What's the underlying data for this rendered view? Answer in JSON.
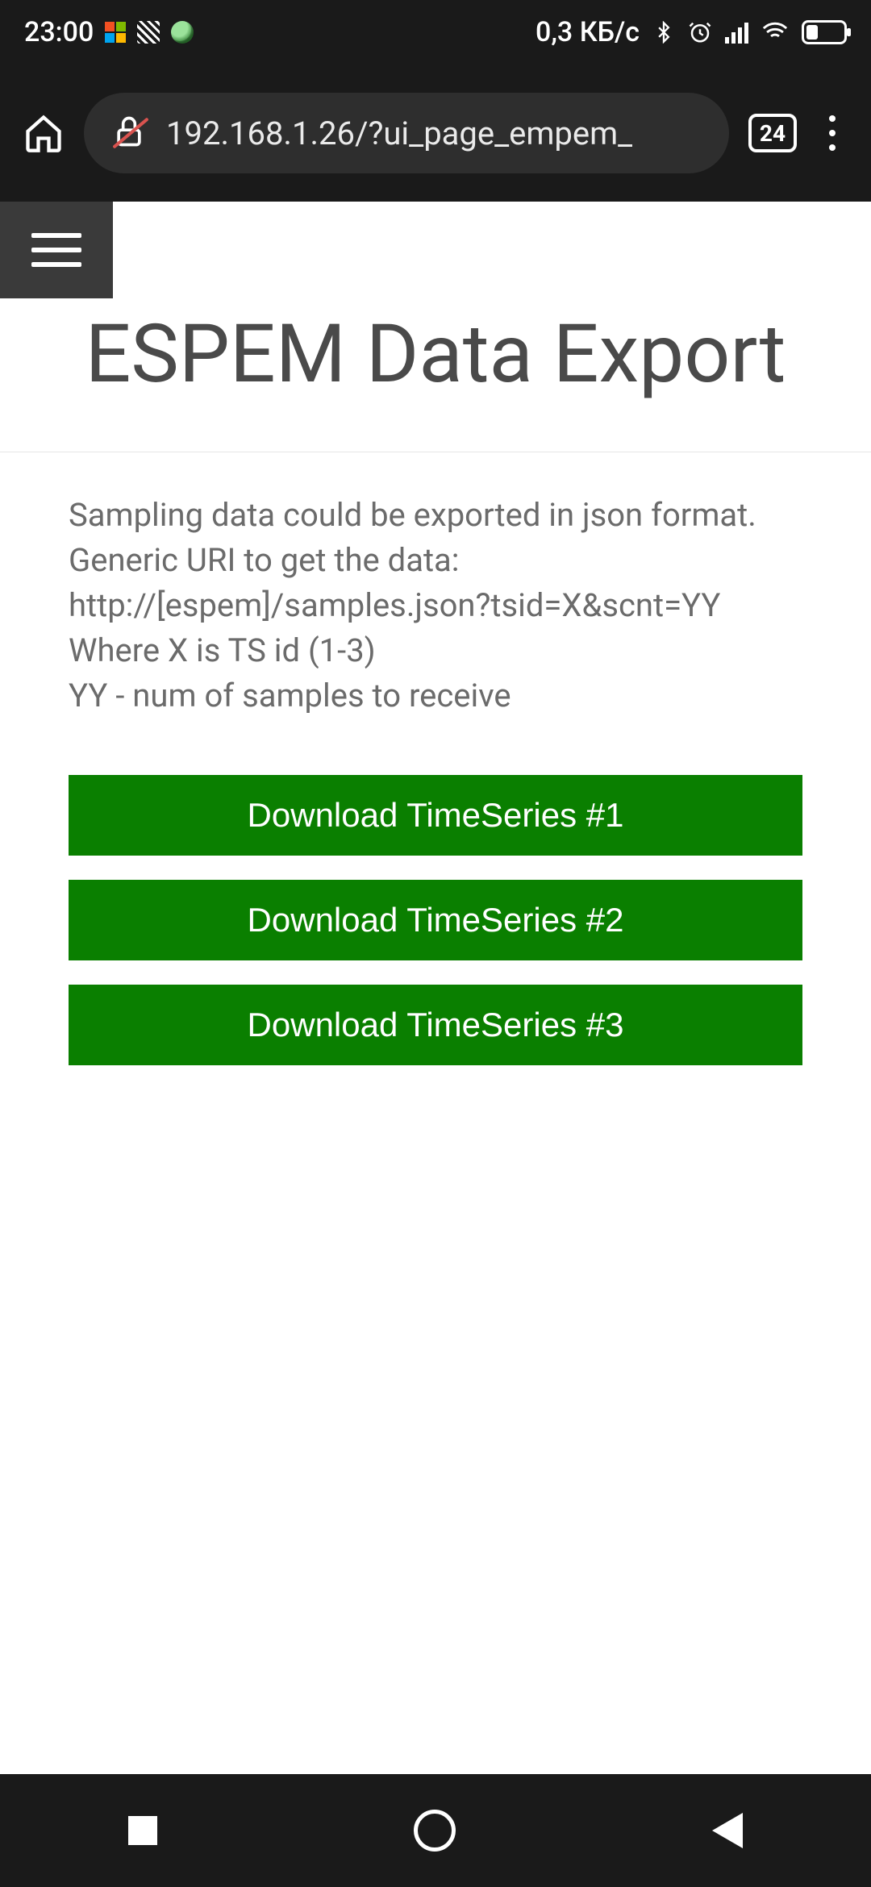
{
  "status": {
    "time": "23:00",
    "net_speed": "0,3 КБ/с"
  },
  "browser": {
    "url": "192.168.1.26/?ui_page_empem_",
    "tab_count": "24"
  },
  "page": {
    "title": "ESPEM Data Export",
    "description": "Sampling data could be exported in json format.\nGeneric URI to get the data: http://[espem]/samples.json?tsid=X&scnt=YY\nWhere X is TS id (1-3)\nYY - num of samples to receive",
    "buttons": [
      "Download TimeSeries #1",
      "Download TimeSeries #2",
      "Download TimeSeries #3"
    ]
  }
}
